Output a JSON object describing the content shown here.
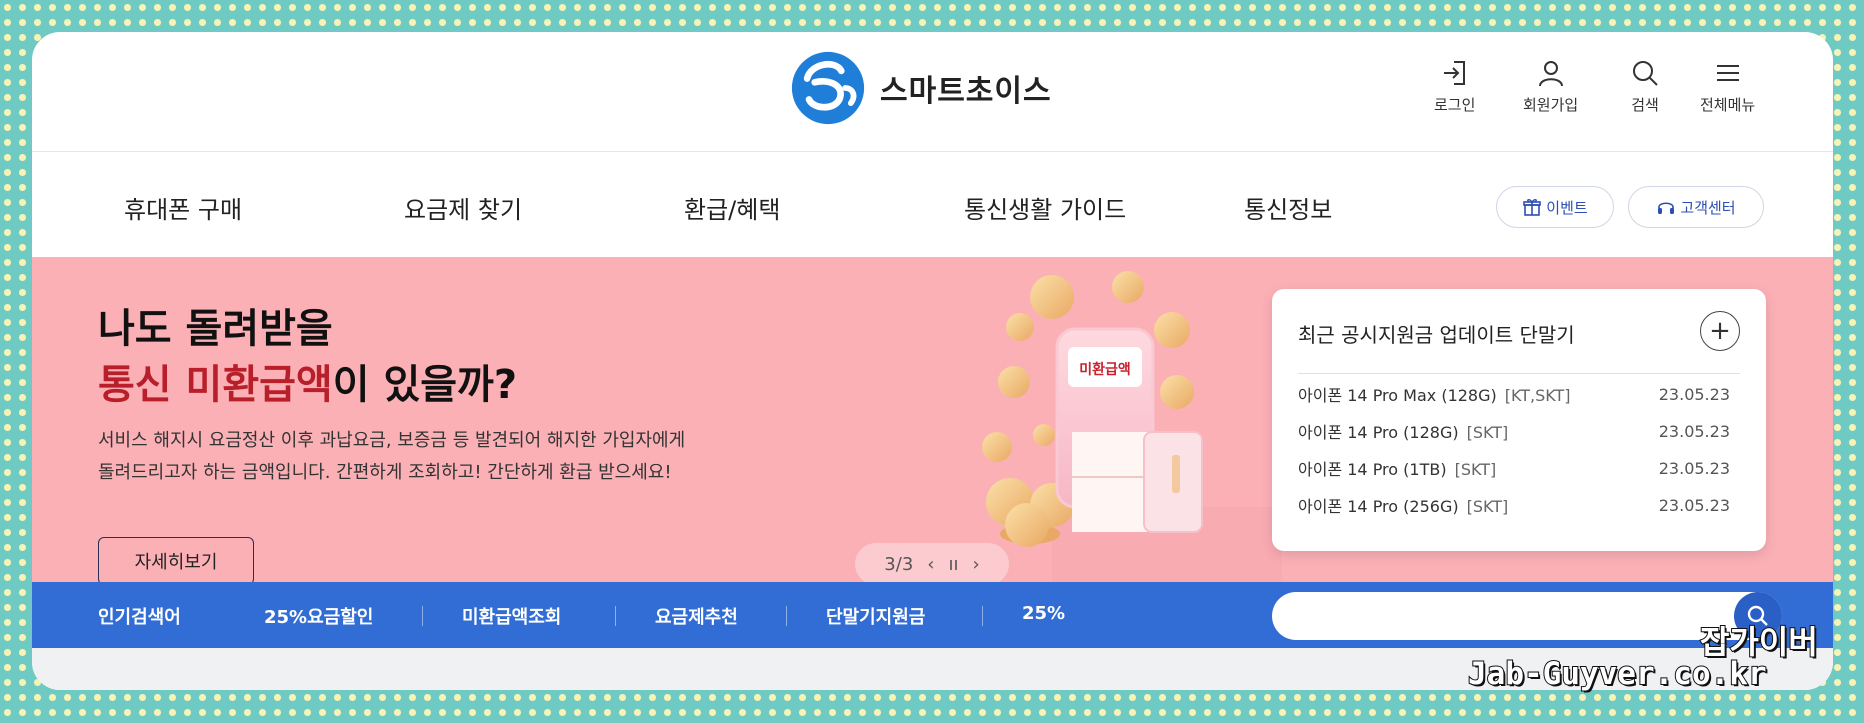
{
  "brand": {
    "name": "스마트초이스",
    "mark_colors": [
      "#1e7ed8",
      "#0f63c4"
    ]
  },
  "utility": [
    {
      "label": "로그인",
      "icon": "login-icon"
    },
    {
      "label": "회원가입",
      "icon": "user-icon"
    },
    {
      "label": "검색",
      "icon": "search-icon"
    },
    {
      "label": "전체메뉴",
      "icon": "menu-icon"
    }
  ],
  "nav": {
    "items": [
      "휴대폰 구매",
      "요금제 찾기",
      "환급/혜택",
      "통신생활 가이드",
      "통신정보"
    ],
    "event_label": "이벤트",
    "support_label": "고객센터"
  },
  "banner": {
    "title_line1": "나도 돌려받을",
    "title_highlight": "통신 미환급액",
    "title_rest": "이 있을까?",
    "desc_line1": "서비스 해지시 요금정산 이후 과납요금, 보증금 등 발견되어 해지한 가입자에게",
    "desc_line2": "돌려드리고자 하는 금액입니다. 간편하게 조회하고! 간단하게 환급 받으세요!",
    "button_label": "자세히보기",
    "illustration_label": "미환급액",
    "pager": {
      "current": "3/3",
      "prev": "‹",
      "pause": "ıı",
      "next": "›"
    },
    "bg_color": "#fbb0b6",
    "accent_color": "#b81f2a"
  },
  "support_card": {
    "title": "최근 공시지원금 업데이트 단말기",
    "plus": "+",
    "rows": [
      {
        "name": "아이폰 14 Pro Max (128G)",
        "carrier": "[KT,SKT]",
        "date": "23.05.23"
      },
      {
        "name": "아이폰 14 Pro (128G)",
        "carrier": "[SKT]",
        "date": "23.05.23"
      },
      {
        "name": "아이폰 14 Pro (1TB)",
        "carrier": "[SKT]",
        "date": "23.05.23"
      },
      {
        "name": "아이폰 14 Pro (256G)",
        "carrier": "[SKT]",
        "date": "23.05.23"
      }
    ]
  },
  "keywords": {
    "label": "인기검색어",
    "items": [
      "25%요금할인",
      "미환급액조회",
      "요금제추천",
      "단말기지원금",
      "25%"
    ],
    "bar_color": "#316dd4",
    "search_placeholder": ""
  },
  "watermark": {
    "line1": "잡가이버",
    "line2": "Jab-Guyver.co.kr"
  }
}
